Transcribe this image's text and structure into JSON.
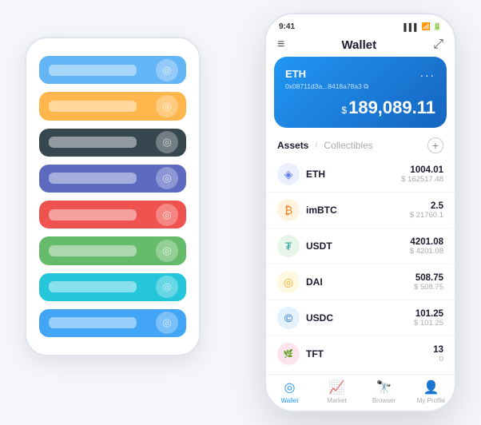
{
  "scene": {
    "background_cards": [
      {
        "color": "#64b5f6",
        "label": "",
        "icon": "🔵"
      },
      {
        "color": "#ffb74d",
        "label": "",
        "icon": "🟡"
      },
      {
        "color": "#37474f",
        "label": "",
        "icon": "⚙️"
      },
      {
        "color": "#5c6bc0",
        "label": "",
        "icon": "🟣"
      },
      {
        "color": "#ef5350",
        "label": "",
        "icon": "🔴"
      },
      {
        "color": "#66bb6a",
        "label": "",
        "icon": "🟢"
      },
      {
        "color": "#26c6da",
        "label": "",
        "icon": "🔵"
      },
      {
        "color": "#42a5f5",
        "label": "",
        "icon": "🔵"
      }
    ]
  },
  "phone": {
    "status_bar": {
      "time": "9:41",
      "signal": "▌▌▌",
      "wifi": "WiFi",
      "battery": "🔋"
    },
    "nav": {
      "menu_icon": "≡",
      "title": "Wallet",
      "expand_icon": "⤢"
    },
    "eth_card": {
      "label": "ETH",
      "dots": "...",
      "address": "0x08711d3a...8418a78a3",
      "copy_icon": "⧉",
      "symbol": "$",
      "amount": "189,089.11"
    },
    "assets_header": {
      "tab_active": "Assets",
      "separator": "/",
      "tab_inactive": "Collectibles",
      "add_icon": "+"
    },
    "assets": [
      {
        "id": "eth",
        "icon_text": "◈",
        "name": "ETH",
        "amount": "1004.01",
        "usd": "$ 162517.48"
      },
      {
        "id": "imbtc",
        "icon_text": "₿",
        "name": "imBTC",
        "amount": "2.5",
        "usd": "$ 21760.1"
      },
      {
        "id": "usdt",
        "icon_text": "₮",
        "name": "USDT",
        "amount": "4201.08",
        "usd": "$ 4201.08"
      },
      {
        "id": "dai",
        "icon_text": "◎",
        "name": "DAI",
        "amount": "508.75",
        "usd": "$ 508.75"
      },
      {
        "id": "usdc",
        "icon_text": "©",
        "name": "USDC",
        "amount": "101.25",
        "usd": "$ 101.25"
      },
      {
        "id": "tft",
        "icon_text": "🌿",
        "name": "TFT",
        "amount": "13",
        "usd": "0"
      }
    ],
    "tab_bar": [
      {
        "id": "wallet",
        "icon": "◎",
        "label": "Wallet",
        "active": true
      },
      {
        "id": "market",
        "icon": "📈",
        "label": "Market",
        "active": false
      },
      {
        "id": "browser",
        "icon": "🔍",
        "label": "Browser",
        "active": false
      },
      {
        "id": "profile",
        "icon": "👤",
        "label": "My Profile",
        "active": false
      }
    ]
  }
}
